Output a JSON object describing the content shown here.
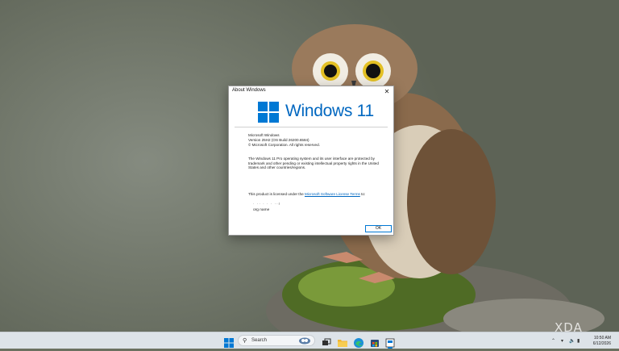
{
  "dialog": {
    "title": "About Windows",
    "close_glyph": "✕",
    "logo_text": "Windows 11",
    "product_name": "Microsoft Windows",
    "version": "Version 25H2 (OS Build 26200.6584)",
    "copyright": "© Microsoft Corporation. All rights reserved.",
    "legal": "The Windows 11 Pro operating system and its user interface are protected by trademark and other pending or existing intellectual property rights in the United States and other countries/regions.",
    "license_prefix": "This product is licensed under the ",
    "license_link": "Microsoft Software License Terms",
    "license_suffix": " to:",
    "owner": "· ·· · ·  ·  ··r",
    "org": "org name",
    "ok_label": "OK"
  },
  "taskbar": {
    "search_placeholder": "Search",
    "time": "10:50 AM",
    "date": "6/12/2026",
    "icons": [
      "windows-start-icon",
      "search-icon",
      "widget-icon",
      "task-view-icon",
      "file-explorer-icon",
      "edge-icon",
      "store-icon",
      "about-app-icon"
    ]
  },
  "watermark": "XDA",
  "colors": {
    "accent": "#0078d4",
    "logo_blue": "#0067c0",
    "taskbar": "#dde3e8"
  }
}
